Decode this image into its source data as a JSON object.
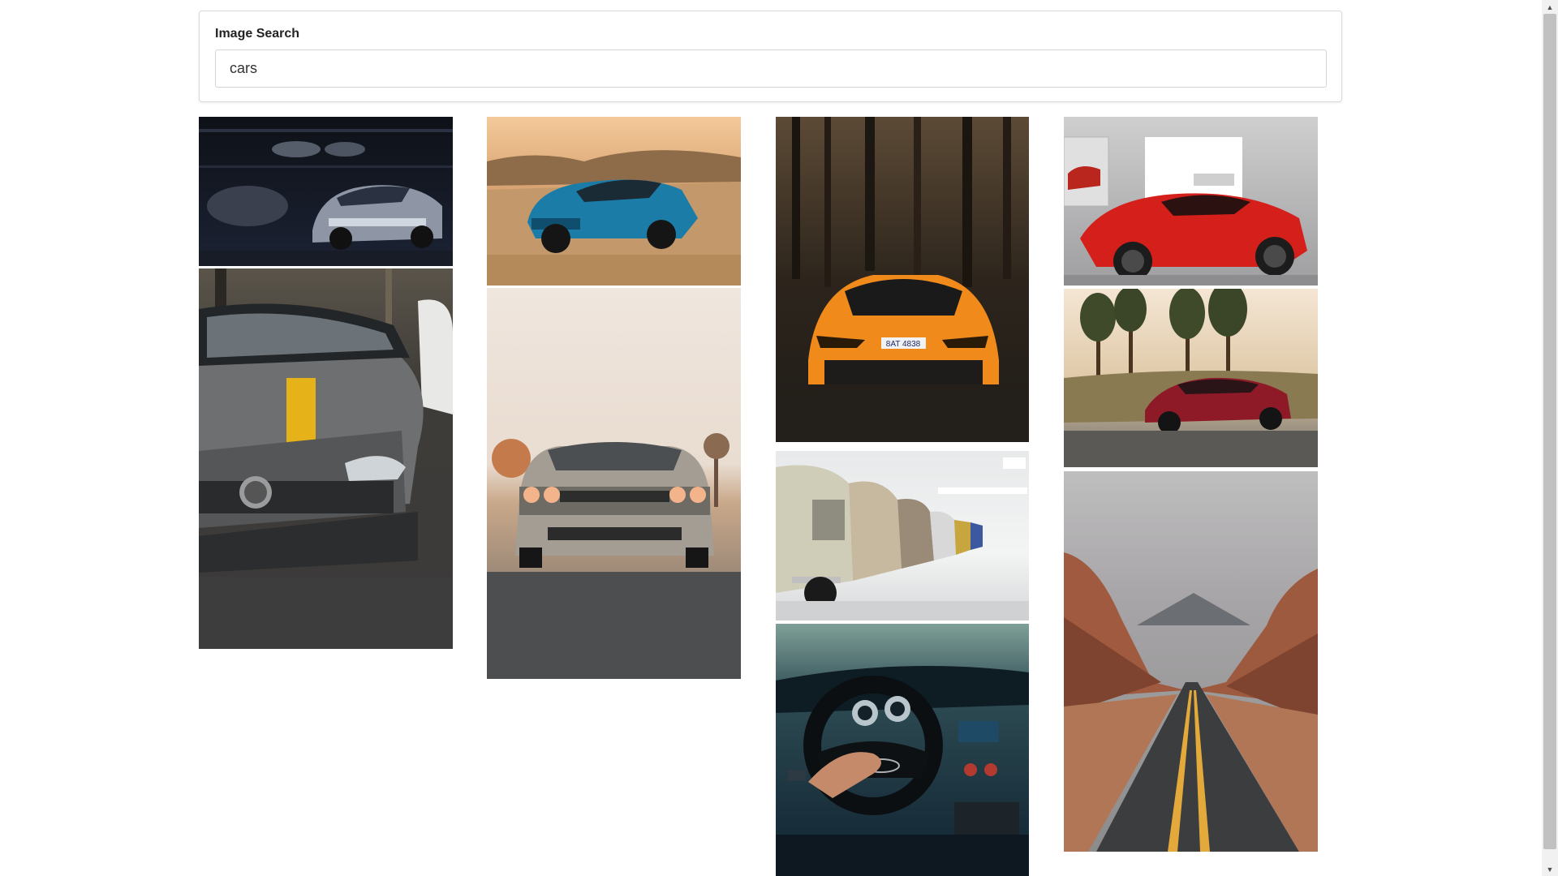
{
  "search": {
    "label": "Image Search",
    "value": "cars",
    "placeholder": ""
  },
  "images": [
    {
      "name": "silver-camaro-garage-image",
      "icon": "photo"
    },
    {
      "name": "grey-mercedes-yellow-stripe-image",
      "icon": "photo"
    },
    {
      "name": "blue-camaro-desert-image",
      "icon": "photo"
    },
    {
      "name": "dodge-challenger-road-image",
      "icon": "photo"
    },
    {
      "name": "orange-lamborghini-forest-image",
      "icon": "photo"
    },
    {
      "name": "row-of-classic-bmws-image",
      "icon": "photo"
    },
    {
      "name": "audi-steering-wheel-interior-image",
      "icon": "photo"
    },
    {
      "name": "red-ferrari-showroom-image",
      "icon": "photo"
    },
    {
      "name": "red-mercedes-amg-forest-road-image",
      "icon": "photo"
    },
    {
      "name": "desert-canyon-road-image",
      "icon": "photo"
    }
  ],
  "plate_text": "8AT 4838",
  "colors": {
    "scrollbar_track": "#f1f1f1",
    "scrollbar_thumb": "#c1c1c1",
    "card_border": "#d9d9d9"
  }
}
